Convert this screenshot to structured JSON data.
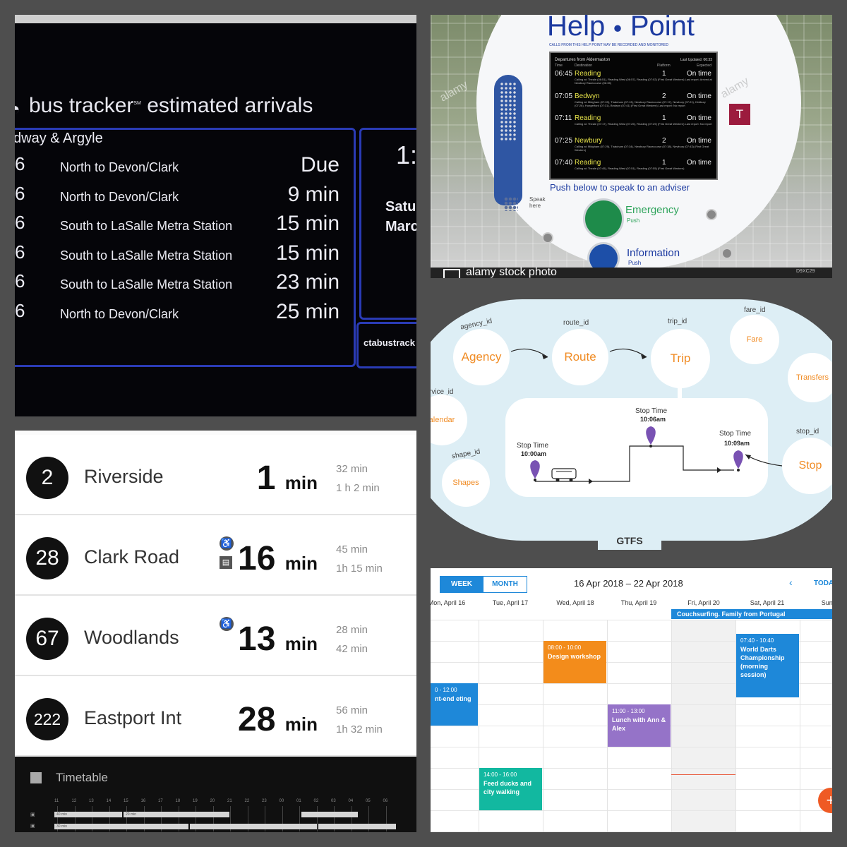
{
  "bus_tracker": {
    "brand": "bus tracker",
    "brand_tm": "SM",
    "heading": "estimated arrivals",
    "stop": "dway & Argyle",
    "arrivals": [
      {
        "route": "6",
        "destination": "North to Devon/Clark",
        "eta": "Due"
      },
      {
        "route": "6",
        "destination": "North to Devon/Clark",
        "eta": "9 min"
      },
      {
        "route": "6",
        "destination": "South to LaSalle Metra Station",
        "eta": "15 min"
      },
      {
        "route": "6",
        "destination": "South to LaSalle Metra Station",
        "eta": "15 min"
      },
      {
        "route": "6",
        "destination": "South to LaSalle Metra Station",
        "eta": "23 min"
      },
      {
        "route": "6",
        "destination": "North to Devon/Clark",
        "eta": "25 min"
      }
    ],
    "clock": "1:",
    "day_line1": "Satu",
    "day_line2": "Marc",
    "url": "ctabustrack"
  },
  "help_point": {
    "title_left": "Help",
    "title_right": "Point",
    "notice": "CALLS FROM THIS HELP POINT MAY BE RECORDED AND MONITORED",
    "screen_heading": "Departures from Aldermaston",
    "screen_updated": "Last Updated: 06:33",
    "columns": {
      "time": "Time",
      "destination": "Destination",
      "platform": "Platform",
      "expected": "Expected"
    },
    "departures": [
      {
        "time": "06:45",
        "destination": "Reading",
        "platform": "1",
        "expected": "On time",
        "calling": "Calling at: Theale (06:51), Reading West (06:57), Reading (07:02) (First Great Western) Last report: Arrived at Newbury Racecourse (06:35)"
      },
      {
        "time": "07:05",
        "destination": "Bedwyn",
        "platform": "2",
        "expected": "On time",
        "calling": "Calling at: Midgham (07:09), Thatcham (07:13), Newbury Racecourse (07:17), Newbury (07:21), Kintbury (07:26), Hungerford (07:31), Bedwyn (07:41) (First Great Western) Last report: No report"
      },
      {
        "time": "07:11",
        "destination": "Reading",
        "platform": "1",
        "expected": "On time",
        "calling": "Calling at: Theale (07:17), Reading West (07:25), Reading (07:29) (First Great Western) Last report: No report"
      },
      {
        "time": "07:25",
        "destination": "Newbury",
        "platform": "2",
        "expected": "On time",
        "calling": "Calling at: Midgham (07:29), Thatcham (07:34), Newbury Racecourse (07:38), Newbury (07:43) (First Great Western)"
      },
      {
        "time": "07:40",
        "destination": "Reading",
        "platform": "1",
        "expected": "On time",
        "calling": "Calling at: Theale (07:45), Reading West (07:51), Reading (07:55) (First Great Western)"
      }
    ],
    "hearing_loop": "T",
    "push_instruction": "Push below to speak to an adviser",
    "speak_here_1": "Speak",
    "speak_here_2": "here",
    "emergency_label": "Emergency",
    "emergency_push": "Push",
    "information_label": "Information",
    "information_push": "Push",
    "watermark": "alamy stock photo",
    "watermark_code": "D9XC29",
    "watermark_overlay": "alamy"
  },
  "gtfs": {
    "title": "GTFS",
    "nodes": {
      "agency": "Agency",
      "route": "Route",
      "trip": "Trip",
      "fare": "Fare",
      "transfers": "Transfers",
      "calendar": "alendar",
      "shapes": "Shapes",
      "stop": "Stop"
    },
    "ids": {
      "agency_id": "agency_id",
      "route_id": "route_id",
      "trip_id": "trip_id",
      "fare_id": "fare_id",
      "service_id": "rvice_id",
      "shape_id": "shape_id",
      "stop_id": "stop_id"
    },
    "stop_times": [
      {
        "label": "Stop Time",
        "time": "10:00am"
      },
      {
        "label": "Stop Time",
        "time": "10:06am"
      },
      {
        "label": "Stop Time",
        "time": "10:09am"
      }
    ]
  },
  "arrivals_app": {
    "rows": [
      {
        "route": "2",
        "destination": "Riverside",
        "eta_value": "1",
        "eta_unit": "min",
        "next1": "32 min",
        "next2": "1 h 2 min"
      },
      {
        "route": "28",
        "destination": "Clark Road",
        "eta_value": "16",
        "eta_unit": "min",
        "next1": "45 min",
        "next2": "1h 15 min"
      },
      {
        "route": "67",
        "destination": "Woodlands",
        "eta_value": "13",
        "eta_unit": "min",
        "next1": "28 min",
        "next2": "42 min"
      },
      {
        "route": "222",
        "destination": "Eastport Int",
        "eta_value": "28",
        "eta_unit": "min",
        "next1": "56 min",
        "next2": "1h 32 min"
      }
    ],
    "timetable_label": "Timetable",
    "timetable_hours": [
      "11",
      "12",
      "13",
      "14",
      "15",
      "16",
      "17",
      "18",
      "19",
      "20",
      "21",
      "22",
      "23",
      "00",
      "01",
      "02",
      "03",
      "04",
      "05",
      "06"
    ],
    "timetable_row1_left": "40 min",
    "timetable_row1_mid": "20 min",
    "timetable_row2_left": "30 min",
    "timetable_row2_mid": "30 min"
  },
  "calendar": {
    "view_week": "WEEK",
    "view_month": "MONTH",
    "range": "16 Apr 2018 – 22 Apr 2018",
    "prev_icon": "‹",
    "today": "TODA",
    "days": [
      "Mon, April 16",
      "Tue, April 17",
      "Wed, April 18",
      "Thu, April 19",
      "Fri, April 20",
      "Sat, April 21",
      "Sun, A"
    ],
    "all_day_event": "Couchsurfing. Family from Portugal",
    "events": [
      {
        "time": "08:00 - 10:00",
        "name": "Design workshop",
        "color": "#f38c1b"
      },
      {
        "time": "07:40 - 10:40",
        "name": "World Darts Championship (morning session)",
        "color": "#1e88d9"
      },
      {
        "time": "0 - 12:00",
        "name": "nt-end eting",
        "color": "#1e88d9"
      },
      {
        "time": "11:00 - 13:00",
        "name": "Lunch with Ann & Alex",
        "color": "#9573c8"
      },
      {
        "time": "14:00 - 16:00",
        "name": "Feed ducks and city walking",
        "color": "#12b8a0"
      }
    ],
    "fab_icon": "+"
  }
}
